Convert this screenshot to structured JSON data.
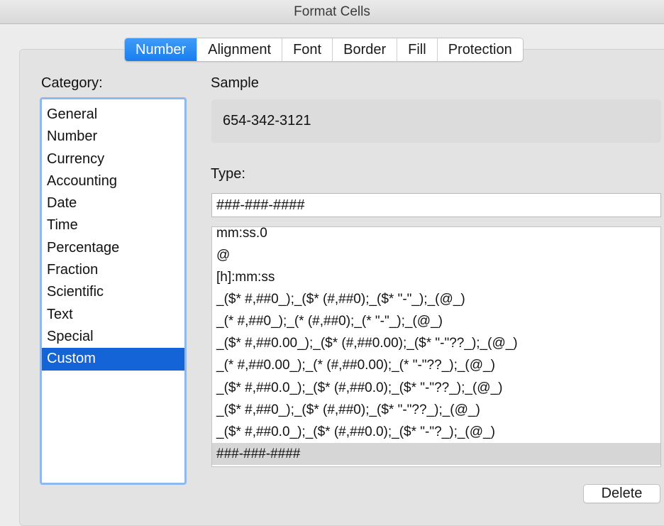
{
  "window": {
    "title": "Format Cells"
  },
  "tabs": [
    {
      "label": "Number",
      "active": true
    },
    {
      "label": "Alignment",
      "active": false
    },
    {
      "label": "Font",
      "active": false
    },
    {
      "label": "Border",
      "active": false
    },
    {
      "label": "Fill",
      "active": false
    },
    {
      "label": "Protection",
      "active": false
    }
  ],
  "category": {
    "label": "Category:",
    "items": [
      "General",
      "Number",
      "Currency",
      "Accounting",
      "Date",
      "Time",
      "Percentage",
      "Fraction",
      "Scientific",
      "Text",
      "Special",
      "Custom"
    ],
    "selected": "Custom"
  },
  "sample": {
    "label": "Sample",
    "value": "654-342-3121"
  },
  "type": {
    "label": "Type:",
    "value": "###-###-####",
    "items": [
      "mm:ss.0",
      "@",
      "[h]:mm:ss",
      "_($* #,##0_);_($* (#,##0);_($* \"-\"_);_(@_)",
      "_(* #,##0_);_(* (#,##0);_(* \"-\"_);_(@_)",
      "_($* #,##0.00_);_($* (#,##0.00);_($* \"-\"??_);_(@_)",
      "_(* #,##0.00_);_(* (#,##0.00);_(* \"-\"??_);_(@_)",
      "_($* #,##0.0_);_($* (#,##0.0);_($* \"-\"??_);_(@_)",
      "_($* #,##0_);_($* (#,##0);_($* \"-\"??_);_(@_)",
      "_($* #,##0.0_);_($* (#,##0.0);_($* \"-\"?_);_(@_)",
      "###-###-####"
    ],
    "selected": "###-###-####"
  },
  "buttons": {
    "delete": "Delete"
  },
  "colors": {
    "accent": "#1a7ef0",
    "selection": "#1464d8",
    "focus_ring": "#8fb9ee"
  }
}
